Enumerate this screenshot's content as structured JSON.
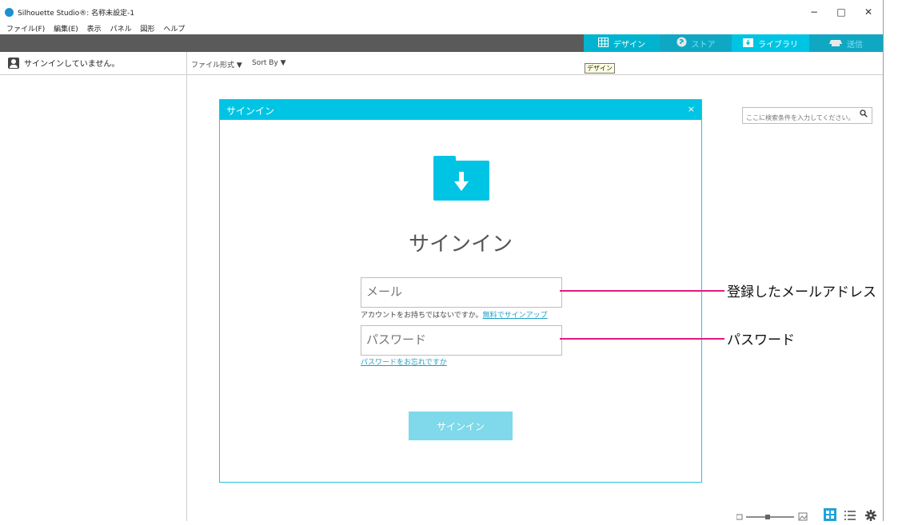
{
  "window": {
    "title": "Silhouette Studio®: 名称未設定-1",
    "minimize_glyph": "−",
    "maximize_glyph": "□",
    "close_glyph": "✕"
  },
  "menu": [
    "ファイル(F)",
    "編集(E)",
    "表示",
    "パネル",
    "図形",
    "ヘルプ"
  ],
  "nav": {
    "design": "デザイン",
    "store": "ストア",
    "library": "ライブラリ",
    "send": "送信"
  },
  "toolbar": {
    "signin_status": "サインインしていません。",
    "file_format": "ファイル形式 ▼",
    "sort_by": "Sort By ▼",
    "tooltip": "デザイン",
    "search_placeholder": "ここに検索条件を入力してください。"
  },
  "dialog": {
    "title": "サインイン",
    "close": "×",
    "heading": "サインイン",
    "email_placeholder": "メール",
    "no_account": "アカウントをお持ちではないですか。",
    "signup_link": "無料でサインアップ",
    "password_placeholder": "パスワード",
    "forgot_link": "パスワードをお忘れですか",
    "signin_button": "サインイン"
  },
  "annotations": {
    "email": "登録したメールアドレス",
    "password": "パスワード"
  },
  "colors": {
    "accent": "#00c4e4",
    "annotation": "#e2197e",
    "navbar": "#5a5a5a"
  }
}
